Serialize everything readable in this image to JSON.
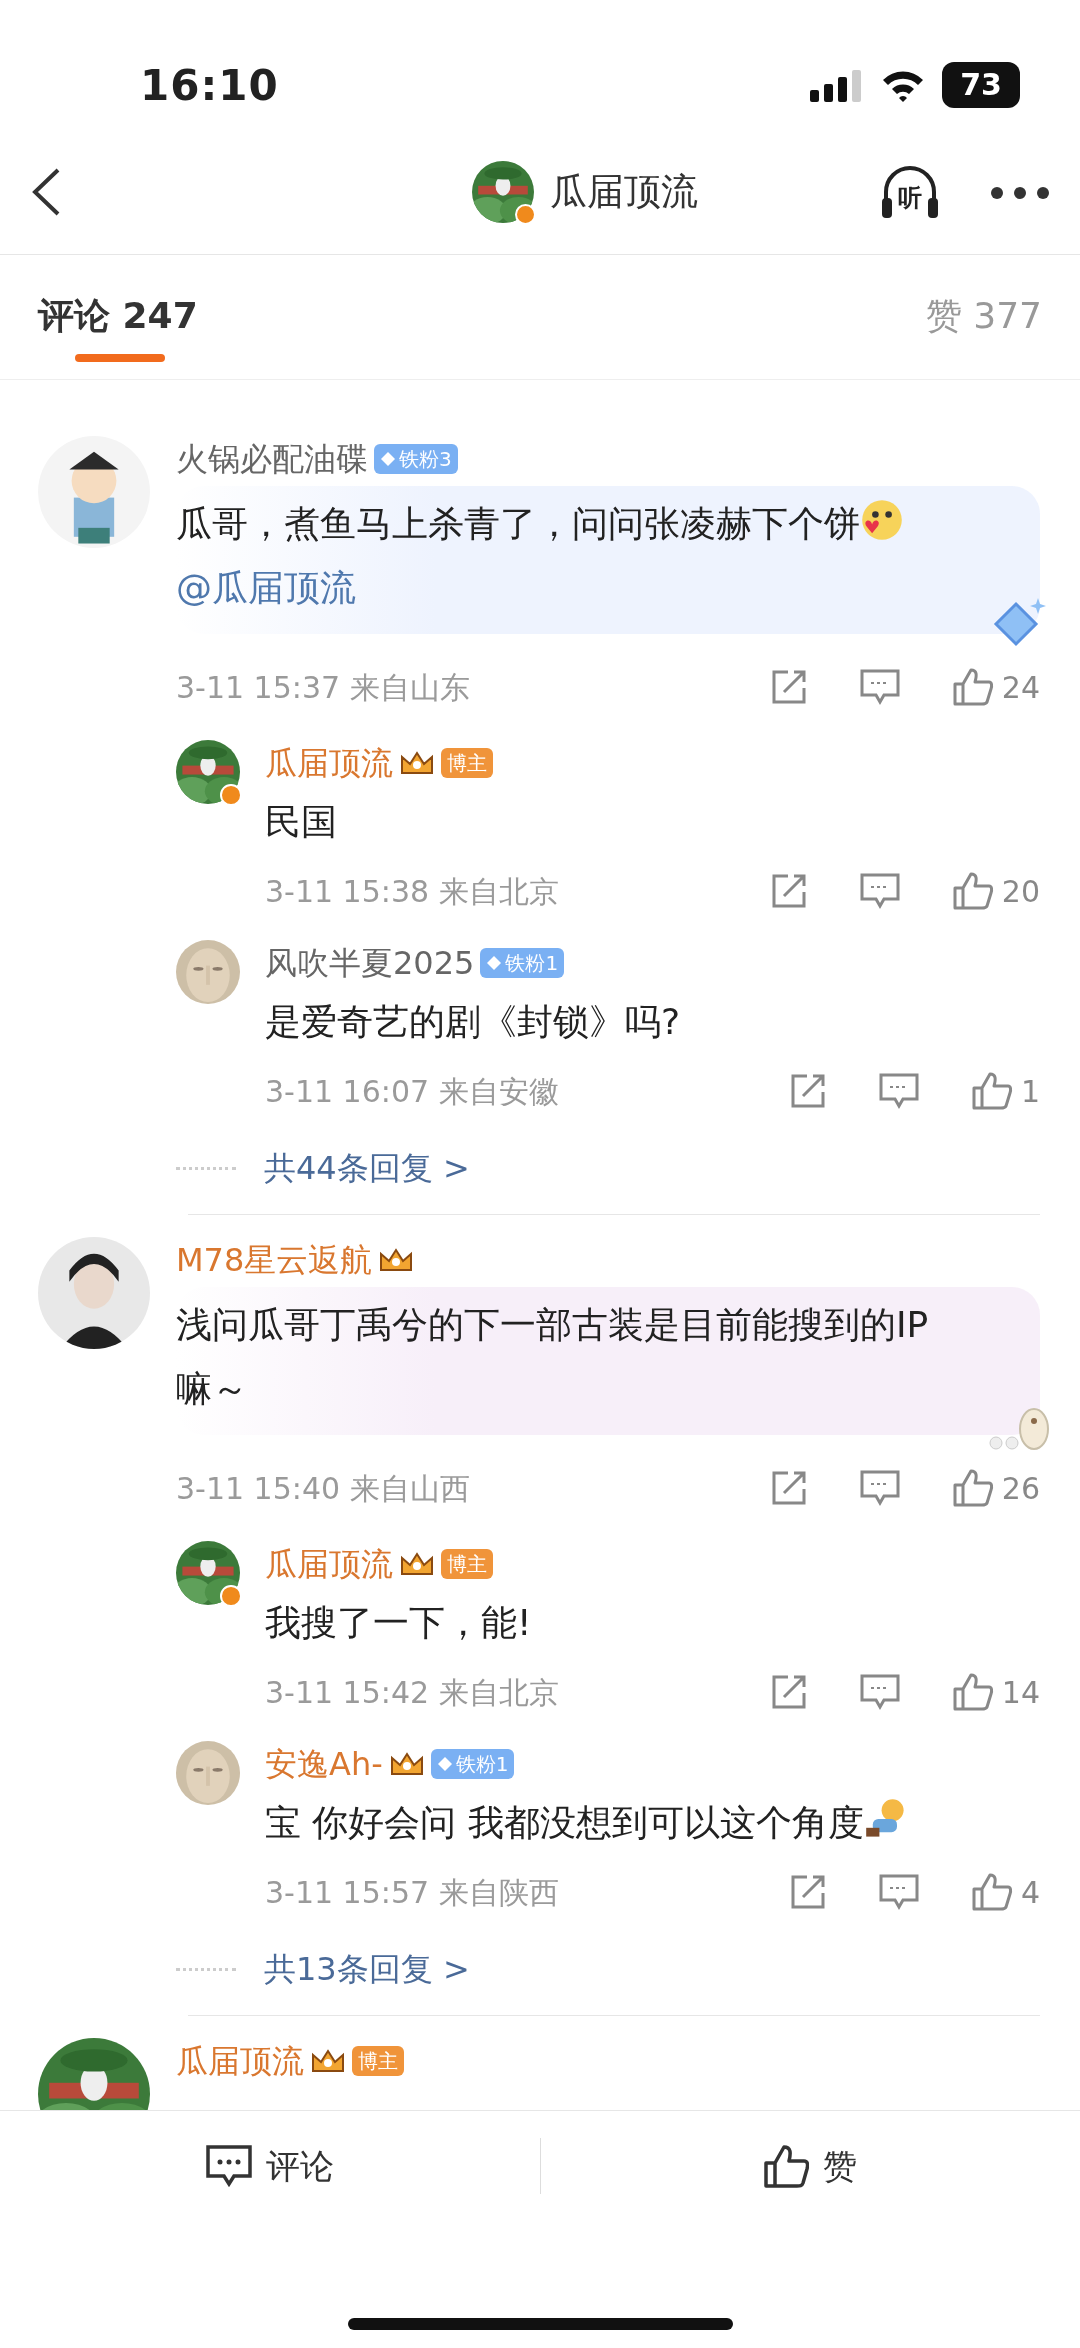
{
  "status_bar": {
    "time": "16:10",
    "battery": "73"
  },
  "nav": {
    "title": "瓜届顶流",
    "verified": true,
    "listen_label": "听"
  },
  "tabs": [
    {
      "label": "评论 247",
      "selected": true
    },
    {
      "label": "赞 377",
      "selected": false
    }
  ],
  "comments": [
    {
      "author": "火锅必配油碟",
      "vip": false,
      "verified": false,
      "badge": {
        "crown": false,
        "kind": "fan",
        "label": "铁粉3"
      },
      "bubble": {
        "kind": "diamond",
        "color": "#eef3fe"
      },
      "body": "瓜哥，煮鱼马上杀青了，问问张凌赫下个饼",
      "sticker": {
        "kind": "emoji"
      },
      "mention": "@瓜届顶流",
      "time": "3-11 15:37",
      "location": "来自山东",
      "likes": "24",
      "replies": [
        {
          "author": "瓜届顶流",
          "vip": true,
          "verified": true,
          "badge": {
            "crown": true,
            "kind": "blogger",
            "label": "博主"
          },
          "body": "民国",
          "time": "3-11 15:38",
          "location": "来自北京",
          "likes": "20"
        },
        {
          "author": "风吹半夏2025",
          "vip": false,
          "verified": false,
          "badge": {
            "crown": false,
            "kind": "fan",
            "label": "铁粉1"
          },
          "body": "是爱奇艺的剧《封锁》吗?",
          "time": "3-11 16:07",
          "location": "来自安徽",
          "likes": "1"
        }
      ],
      "more_replies": "共44条回复 >"
    },
    {
      "author": "M78星云返航",
      "vip": true,
      "verified": false,
      "badge": {
        "crown": true
      },
      "bubble": {
        "kind": "bear",
        "color": "#f7eff9"
      },
      "body": "浅问瓜哥丁禹兮的下一部古装是目前能搜到的IP嘛～",
      "time": "3-11 15:40",
      "location": "来自山西",
      "likes": "26",
      "replies": [
        {
          "author": "瓜届顶流",
          "vip": true,
          "verified": true,
          "badge": {
            "crown": true,
            "kind": "blogger",
            "label": "博主"
          },
          "body": "我搜了一下，能!",
          "time": "3-11 15:42",
          "location": "来自北京",
          "likes": "14"
        },
        {
          "author": "安逸Ah-",
          "vip": true,
          "verified": false,
          "badge": {
            "crown": true,
            "kind": "fan",
            "label": "铁粉1"
          },
          "body": "宝 你好会问 我都没想到可以这个角度",
          "sticker": {
            "kind": "figure"
          },
          "time": "3-11 15:57",
          "location": "来自陕西",
          "likes": "4"
        }
      ],
      "more_replies": "共13条回复 >"
    },
    {
      "author": "瓜届顶流",
      "vip": true,
      "verified": false,
      "badge": {
        "crown": true,
        "kind": "blogger",
        "label": "博主"
      }
    }
  ],
  "bottom_bar": [
    {
      "kind": "comment",
      "label": "评论"
    },
    {
      "kind": "like",
      "label": "赞"
    }
  ]
}
